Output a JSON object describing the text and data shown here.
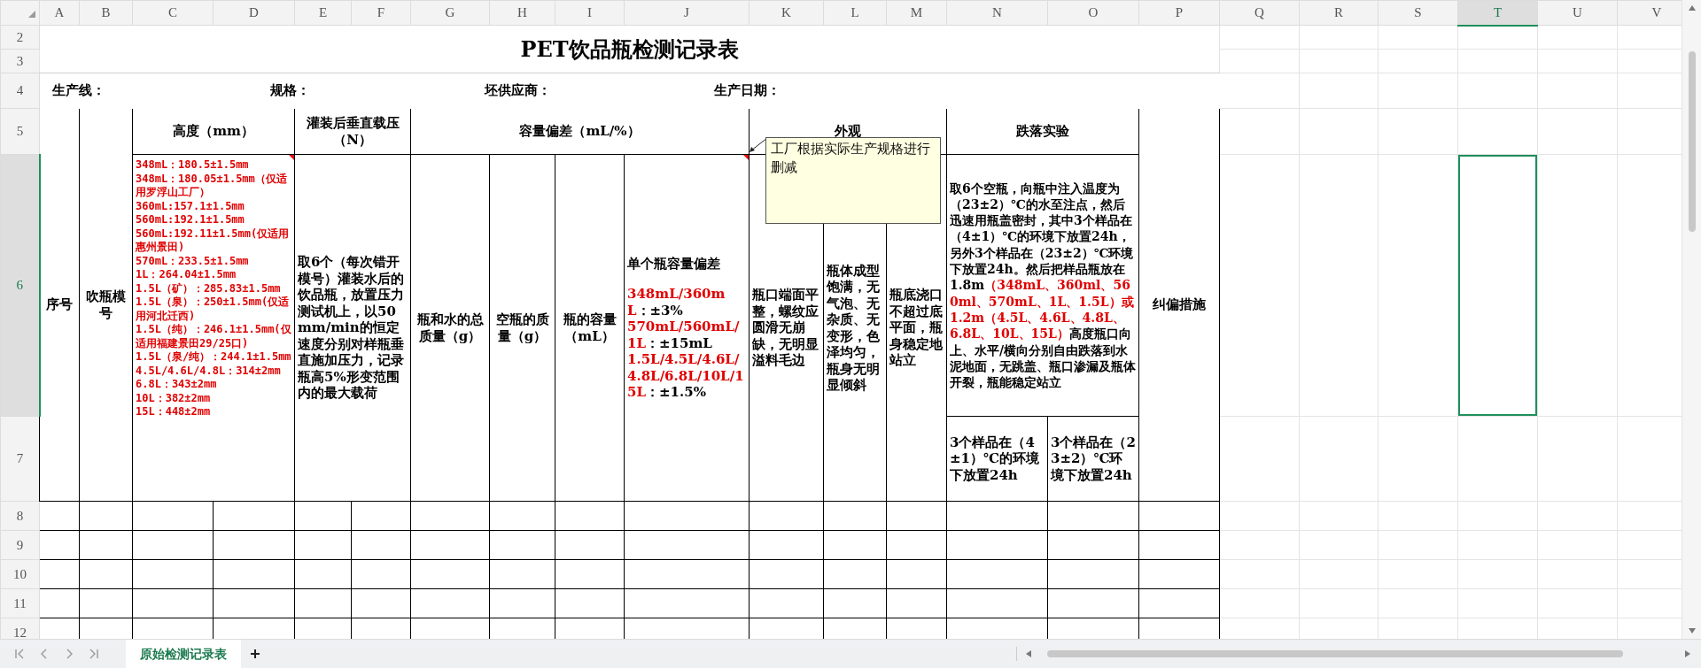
{
  "columns": [
    {
      "label": "A",
      "selected": false
    },
    {
      "label": "B",
      "selected": false
    },
    {
      "label": "C",
      "selected": false
    },
    {
      "label": "D",
      "selected": false
    },
    {
      "label": "E",
      "selected": false
    },
    {
      "label": "F",
      "selected": false
    },
    {
      "label": "G",
      "selected": false
    },
    {
      "label": "H",
      "selected": false
    },
    {
      "label": "I",
      "selected": false
    },
    {
      "label": "J",
      "selected": false
    },
    {
      "label": "K",
      "selected": false
    },
    {
      "label": "L",
      "selected": false
    },
    {
      "label": "M",
      "selected": false
    },
    {
      "label": "N",
      "selected": false
    },
    {
      "label": "O",
      "selected": false
    },
    {
      "label": "P",
      "selected": false
    },
    {
      "label": "Q",
      "selected": false
    },
    {
      "label": "R",
      "selected": false
    },
    {
      "label": "S",
      "selected": false
    },
    {
      "label": "T",
      "selected": true
    },
    {
      "label": "U",
      "selected": false
    },
    {
      "label": "V",
      "selected": false
    }
  ],
  "rows": [
    {
      "label": "2",
      "selected": false
    },
    {
      "label": "3",
      "selected": false
    },
    {
      "label": "4",
      "selected": false
    },
    {
      "label": "5",
      "selected": false
    },
    {
      "label": "6",
      "selected": true
    },
    {
      "label": "7",
      "selected": false
    },
    {
      "label": "8",
      "selected": false
    },
    {
      "label": "9",
      "selected": false
    },
    {
      "label": "10",
      "selected": false
    },
    {
      "label": "11",
      "selected": false
    },
    {
      "label": "12",
      "selected": false
    }
  ],
  "title": "PET饮品瓶检测记录表",
  "info": [
    "生产线：",
    "规格：",
    "坯供应商：",
    "生产日期："
  ],
  "header": {
    "seq": "序号",
    "mold": "吹瓶模号",
    "height": "高度（mm）",
    "load": "灌装后垂直载压（N）",
    "capacity": "容量偏差（mL/%）",
    "appearance": "外观",
    "drop": "跌落实验",
    "correction": "纠偏措施"
  },
  "height_spec": [
    "348mL：180.5±1.5mm",
    "348mL：180.05±1.5mm（仅适用罗浮山工厂）",
    "360mL:157.1±1.5mm",
    "560mL:192.1±1.5mm",
    "560mL:192.11±1.5mm(仅适用惠州景田)",
    "570mL：233.5±1.5mm",
    "1L：264.04±1.5mm",
    "1.5L（矿）：285.83±1.5mm",
    "1.5L（泉）：250±1.5mm(仅适用河北迁西)",
    "1.5L（纯）：246.1±1.5mm(仅适用福建景田29/25口)",
    "1.5L（泉/纯）：244.1±1.5mm",
    "4.5L/4.6L/4.8L：314±2mm",
    "6.8L：343±2mm",
    "10L：382±2mm",
    "15L：448±2mm"
  ],
  "load_method": "取6个（每次错开模号）灌装水后的饮品瓶，放置压力测试机上，以50mm/min的恒定速度分别对样瓶垂直施加压力，记录瓶高5%形变范围内的最大载荷",
  "capacity_columns": [
    "瓶和水的总质量（g）",
    "空瓶的质量（g）",
    "瓶的容量（mL）"
  ],
  "capacity_spec": {
    "heading": "单个瓶容量偏差",
    "lines": [
      [
        {
          "kind": "highlight",
          "text": "348mL/360mL"
        },
        {
          "kind": "plain",
          "text": "：±3%"
        }
      ],
      [
        {
          "kind": "highlight",
          "text": "570mL/560mL/1L"
        },
        {
          "kind": "plain",
          "text": "：±15mL"
        }
      ],
      [
        {
          "kind": "highlight",
          "text": "1.5L/4.5L/4.6L/4.8L/6.8L/10L/15L"
        },
        {
          "kind": "plain",
          "text": "：±1.5%"
        }
      ]
    ]
  },
  "appearance": [
    "瓶口端面平整，螺纹应圆滑无崩缺，无明显溢料毛边",
    "瓶体成型饱满，无气泡、无杂质、无变形，色泽均匀，瓶身无明显倾斜",
    "瓶底浇口不超过底平面，瓶身稳定地站立"
  ],
  "drop_method": [
    {
      "kind": "plain",
      "text": "取6个空瓶，向瓶中注入温度为（23±2）℃的水至注点，然后迅速用瓶盖密封，其中3个样品在（4±1）℃的环境下放置24h，另外3个样品在（23±2）℃环境下放置24h。然后把样品瓶放在1.8m"
    },
    {
      "kind": "highlight",
      "text": "（348mL、360ml、560ml、570mL、1L、1.5L）或1.2m（4.5L、4.6L、4.8L、6.8L、10L、15L）"
    },
    {
      "kind": "plain",
      "text": "高度瓶口向上、水平/横向分别自由跌落到水泥地面，无跳盖、瓶口渗漏及瓶体开裂，瓶能稳定站立"
    }
  ],
  "drop_conditions": [
    "3个样品在（4±1）℃的环境下放置24h",
    "3个样品在（23±2）℃环境下放置24h"
  ],
  "comment": "工厂根据实际生产规格进行删减",
  "sheet_tabs": [
    {
      "label": "原始检测记录表",
      "selected": true
    }
  ]
}
